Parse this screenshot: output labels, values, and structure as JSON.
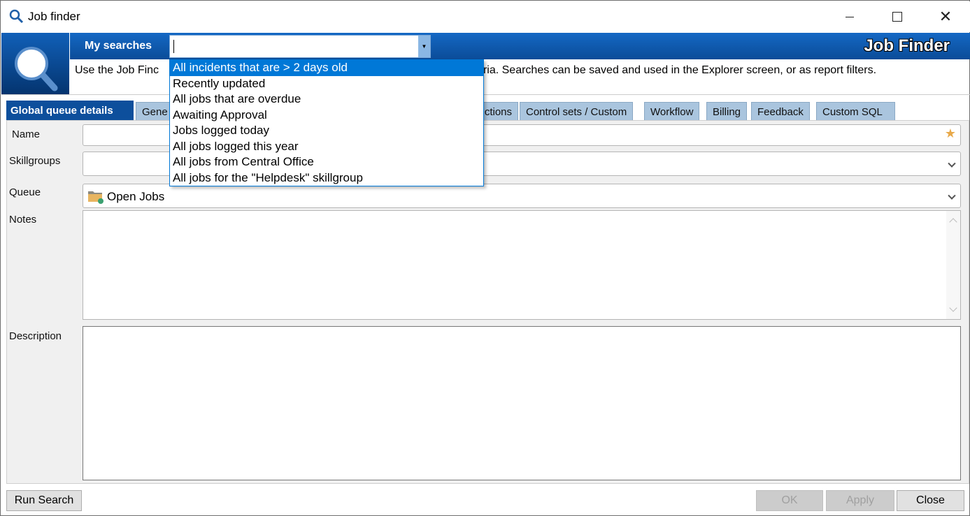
{
  "window": {
    "title": "Job finder",
    "controls": [
      "minimize",
      "maximize",
      "close"
    ]
  },
  "header": {
    "my_searches_label": "My searches",
    "search_value": "",
    "app_title": "Job Finder",
    "description": "Use the Job Finc",
    "description_tail": "eria.  Searches can be saved and used in the Explorer screen, or as report filters."
  },
  "dropdown": {
    "items": [
      "All incidents that are > 2 days old",
      "Recently updated",
      "All jobs that are overdue",
      "Awaiting Approval",
      "Jobs logged today",
      "All jobs logged this year",
      "All jobs from Central Office",
      "All jobs for the \"Helpdesk\" skillgroup"
    ],
    "selected_index": 0
  },
  "tabs": [
    {
      "label": "Global queue details",
      "active": true
    },
    {
      "label": "Gene"
    },
    {
      "label": "ctions"
    },
    {
      "label": "Control sets / Custom"
    },
    {
      "label": "Workflow"
    },
    {
      "label": "Billing"
    },
    {
      "label": "Feedback"
    },
    {
      "label": "Custom SQL"
    }
  ],
  "form": {
    "name_label": "Name",
    "name_value": "",
    "skillgroups_label": "Skillgroups",
    "skillgroups_value": "",
    "queue_label": "Queue",
    "queue_value": "Open Jobs",
    "notes_label": "Notes",
    "notes_value": "",
    "description_label": "Description",
    "description_value": ""
  },
  "buttons": {
    "run_search": "Run Search",
    "ok": "OK",
    "apply": "Apply",
    "close": "Close"
  },
  "colors": {
    "header_blue": "#0b4c98",
    "selection": "#0078d7",
    "tab_inactive": "#aac5de",
    "star": "#e8a94a"
  }
}
